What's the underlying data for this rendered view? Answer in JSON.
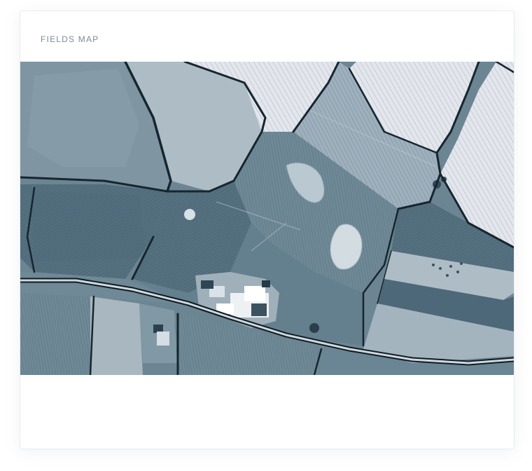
{
  "card": {
    "title": "FIELDS MAP"
  },
  "map": {
    "kind": "satellite-image",
    "tint": "#5f7687",
    "accent": "#e9eef3"
  }
}
